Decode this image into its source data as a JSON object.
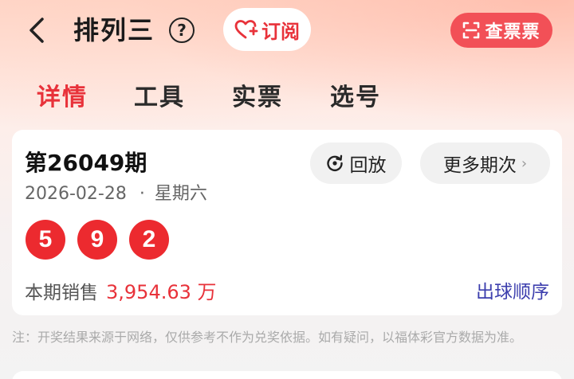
{
  "header": {
    "title": "排列三",
    "help_label": "?",
    "subscribe_label": "订阅",
    "ticket_label": "查票票"
  },
  "tabs": [
    {
      "label": "详情",
      "active": true
    },
    {
      "label": "工具",
      "active": false
    },
    {
      "label": "实票",
      "active": false
    },
    {
      "label": "选号",
      "active": false
    }
  ],
  "draw": {
    "issue": "第26049期",
    "date": "2026-02-28",
    "separator": "·",
    "weekday": "星期六",
    "replay_label": "回放",
    "more_label": "更多期次",
    "more_chevron": "›",
    "numbers": [
      "5",
      "9",
      "2"
    ],
    "sales_label": "本期销售",
    "sales_amount": "3,954.63 万",
    "order_label": "出球顺序"
  },
  "note": "注：开奖结果来源于网络，仅供参考不作为兑奖依据。如有疑问，以福体彩官方数据为准。",
  "colors": {
    "accent": "#e8323a",
    "ball": "#ec2a2f",
    "ticket_button": "#f25057",
    "link": "#3d3fae"
  },
  "icons": {
    "back": "chevron-left-icon",
    "help": "question-circle-icon",
    "subscribe": "heart-plus-icon",
    "ticket": "scan-icon",
    "replay": "replay-icon",
    "more": "chevron-right-icon"
  }
}
